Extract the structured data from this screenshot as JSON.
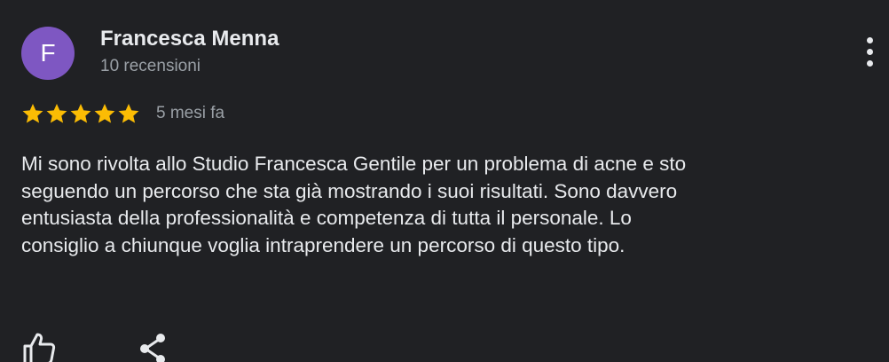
{
  "review": {
    "author": {
      "initial": "F",
      "avatar_color": "#7e57c2",
      "name": "Francesca Menna",
      "meta": "10 recensioni"
    },
    "rating": 5,
    "rating_max": 5,
    "star_color": "#fbbc04",
    "date": "5 mesi fa",
    "text_lines": [
      "Mi sono rivolta allo Studio Francesca Gentile per un problema di acne e sto",
      "seguendo un percorso che sta già mostrando i suoi risultati. Sono davvero",
      "entusiasta della professionalità e competenza di tutta il personale. Lo",
      "consiglio a chiunque voglia intraprendere un percorso di questo tipo."
    ],
    "actions": {
      "like_icon": "thumb-up-icon",
      "share_icon": "share-icon",
      "more_icon": "more-vertical-icon"
    }
  }
}
